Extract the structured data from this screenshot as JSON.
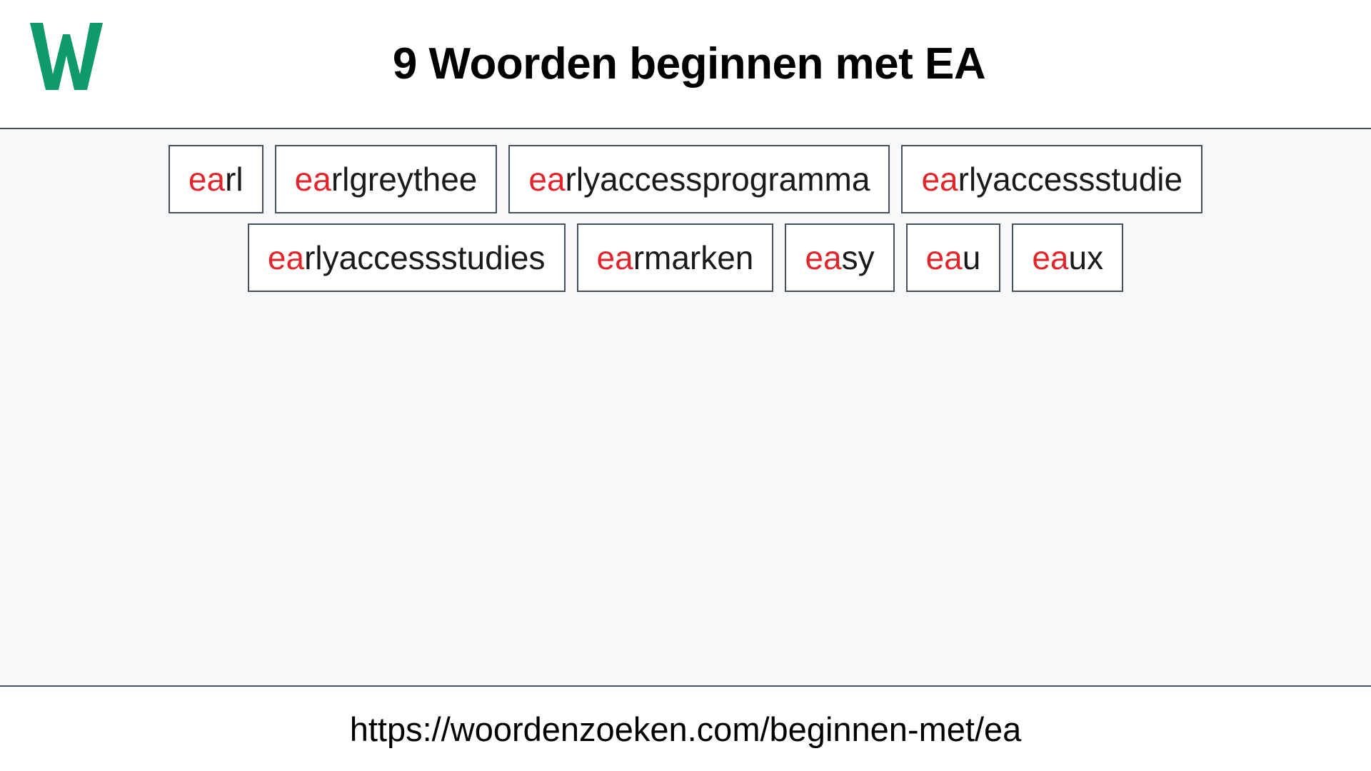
{
  "header": {
    "logo_text": "W",
    "logo_name": "woordenzoeken-w-logo",
    "logo_color": "#0e9a6c",
    "title": "9 Woorden beginnen met EA"
  },
  "main": {
    "highlight_color": "#e1252b",
    "text_color": "#1a1a1a",
    "border_color": "#46505c",
    "background_color": "#f6f8fa",
    "prefix": "ea",
    "rows": [
      [
        {
          "prefix": "ea",
          "rest": "rl",
          "word": "earl"
        },
        {
          "prefix": "ea",
          "rest": "rlgreythee",
          "word": "earlgreythee"
        },
        {
          "prefix": "ea",
          "rest": "rlyaccessprogramma",
          "word": "earlyaccessprogramma"
        },
        {
          "prefix": "ea",
          "rest": "rlyaccessstudie",
          "word": "earlyaccessstudie"
        }
      ],
      [
        {
          "prefix": "ea",
          "rest": "rlyaccessstudies",
          "word": "earlyaccessstudies"
        },
        {
          "prefix": "ea",
          "rest": "rmarken",
          "word": "earmarken"
        },
        {
          "prefix": "ea",
          "rest": "sy",
          "word": "easy"
        },
        {
          "prefix": "ea",
          "rest": "u",
          "word": "eau"
        },
        {
          "prefix": "ea",
          "rest": "ux",
          "word": "eaux"
        }
      ]
    ]
  },
  "footer": {
    "url": "https://woordenzoeken.com/beginnen-met/ea"
  }
}
